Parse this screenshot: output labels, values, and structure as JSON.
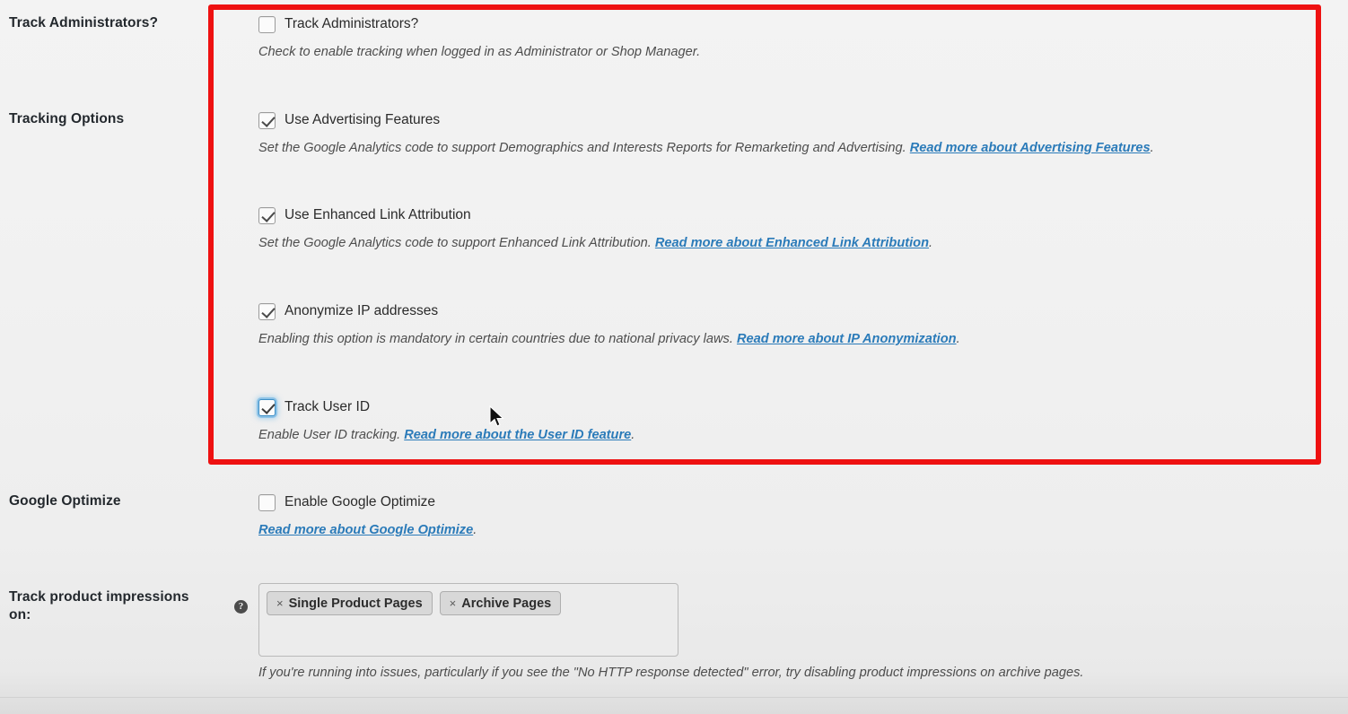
{
  "rows": [
    {
      "label": "Track Administrators?",
      "options": [
        {
          "id": "track-administrators",
          "label": "Track Administrators?",
          "checked": false,
          "focused": false,
          "desc_before": "Check to enable tracking when logged in as Administrator or Shop Manager.",
          "link": "",
          "desc_after": ""
        }
      ]
    },
    {
      "label": "Tracking Options",
      "options": [
        {
          "id": "use-advertising-features",
          "label": "Use Advertising Features",
          "checked": true,
          "focused": false,
          "desc_before": "Set the Google Analytics code to support Demographics and Interests Reports for Remarketing and Advertising. ",
          "link": "Read more about Advertising Features",
          "desc_after": "."
        },
        {
          "id": "use-enhanced-link-attribution",
          "label": "Use Enhanced Link Attribution",
          "checked": true,
          "focused": false,
          "desc_before": "Set the Google Analytics code to support Enhanced Link Attribution. ",
          "link": "Read more about Enhanced Link Attribution",
          "desc_after": "."
        },
        {
          "id": "anonymize-ip-addresses",
          "label": "Anonymize IP addresses",
          "checked": true,
          "focused": false,
          "desc_before": "Enabling this option is mandatory in certain countries due to national privacy laws. ",
          "link": "Read more about IP Anonymization",
          "desc_after": "."
        },
        {
          "id": "track-user-id",
          "label": "Track User ID",
          "checked": true,
          "focused": true,
          "desc_before": "Enable User ID tracking. ",
          "link": "Read more about the User ID feature",
          "desc_after": "."
        }
      ]
    },
    {
      "label": "Google Optimize",
      "options": [
        {
          "id": "enable-google-optimize",
          "label": "Enable Google Optimize",
          "checked": false,
          "focused": false,
          "desc_before": "",
          "link": "Read more about Google Optimize",
          "desc_after": "."
        }
      ]
    }
  ],
  "impressions": {
    "label": "Track product impressions on:",
    "help_icon": "?",
    "tokens": [
      {
        "remove": "×",
        "label": "Single Product Pages"
      },
      {
        "remove": "×",
        "label": "Archive Pages"
      }
    ],
    "note": "If you're running into issues, particularly if you see the \"No HTTP response detected\" error, try disabling product impressions on archive pages."
  },
  "colors": {
    "highlight_border": "#ee1111",
    "link": "#2b7bb9",
    "focus_ring": "#64afe1",
    "page_background": "#f1f1f1"
  }
}
